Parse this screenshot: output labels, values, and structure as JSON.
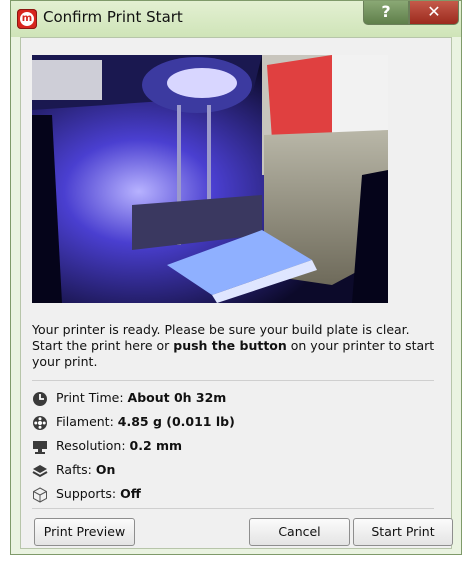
{
  "window": {
    "title": "Confirm Print Start",
    "help_label": "?",
    "close_label": "✕",
    "app_icon_letter": "m"
  },
  "message": {
    "line1": "Your printer is ready. Please be sure your build plate is clear.",
    "line2_pre": "Start the print here or ",
    "line2_bold": "push the button",
    "line2_post": " on your printer to start",
    "line3": "your print."
  },
  "details": {
    "print_time_label": "Print Time: ",
    "print_time_value": "About 0h 32m",
    "filament_label": "Filament: ",
    "filament_value": "4.85 g (0.011 lb)",
    "resolution_label": "Resolution: ",
    "resolution_value": "0.2 mm",
    "rafts_label": "Rafts: ",
    "rafts_value": "On",
    "supports_label": "Supports: ",
    "supports_value": "Off"
  },
  "buttons": {
    "print_preview": "Print Preview",
    "cancel": "Cancel",
    "start_print": "Start Print"
  },
  "colors": {
    "titlebar": "#cfe4b8",
    "close": "#b23a2c",
    "accent_red": "#d7261e"
  },
  "icons": {
    "print_time": "clock-icon",
    "filament": "spool-icon",
    "resolution": "monitor-icon",
    "rafts": "layers-icon",
    "supports": "cube-icon"
  }
}
